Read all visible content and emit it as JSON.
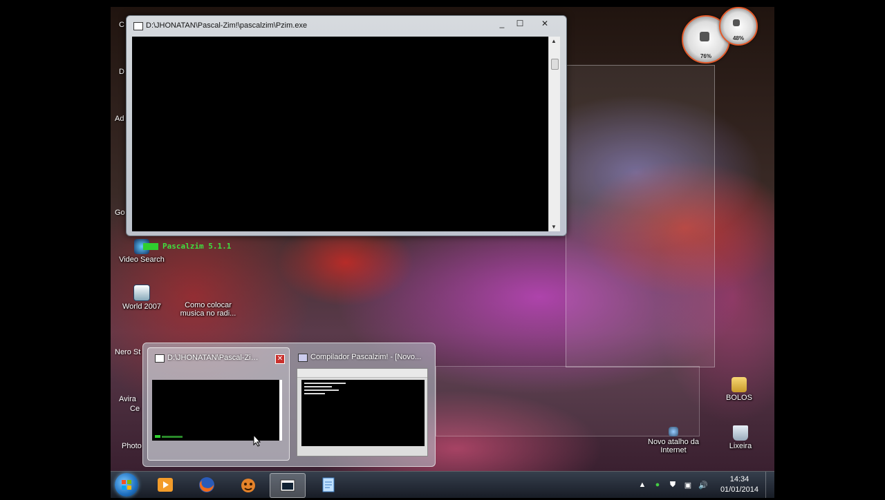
{
  "desktop": {
    "icons": [
      {
        "label": "Video Search",
        "icon": "globe-search-icon"
      },
      {
        "label": "World 2007",
        "icon": "document-icon"
      },
      {
        "label": "Como colocar musica no radi...",
        "icon": "video-file-icon"
      },
      {
        "label": "BOLOS",
        "icon": "folder-icon"
      },
      {
        "label": "Novo atalho da Internet",
        "icon": "internet-shortcut-icon"
      },
      {
        "label": "Lixeira",
        "icon": "recycle-bin-icon"
      }
    ],
    "partial_labels": [
      "C",
      "D",
      "Ad",
      "Go",
      "Nero St",
      "Avira",
      "Ce",
      "Photo"
    ],
    "gadgets": {
      "cpu_percent": "76%",
      "memory_percent": "48%"
    }
  },
  "console_window": {
    "title": "D:\\JHONATAN\\Pascal-Zim!\\pascalzim\\Pzim.exe",
    "status_text": "Pascalzim 5.1.1",
    "controls": [
      "_",
      "☐",
      "✕"
    ]
  },
  "taskbar_preview": {
    "items": [
      {
        "title": "D:\\JHONATAN\\Pascal-Zim!...",
        "close": "✕"
      },
      {
        "title": "Compilador Pascalzim! - [Novo..."
      }
    ]
  },
  "taskbar": {
    "pinned": [
      {
        "name": "media-player-icon"
      },
      {
        "name": "firefox-icon"
      },
      {
        "name": "pascalzim-icon"
      },
      {
        "name": "console-app-icon",
        "active": true
      },
      {
        "name": "notepad-icon"
      }
    ],
    "tray_symbols": [
      "▲",
      "●",
      "⛊",
      "▣",
      "🔊"
    ],
    "time": "14:34",
    "date": "01/01/2014"
  },
  "colors": {
    "console_green": "#3fe03f",
    "close_red": "#c9302c",
    "start_blue": "#1e6fbf"
  }
}
